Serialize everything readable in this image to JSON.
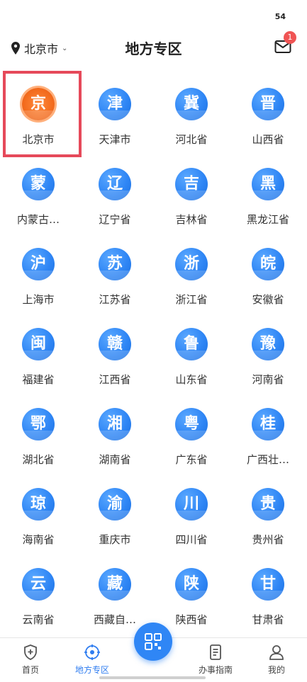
{
  "status": {
    "time": "54"
  },
  "header": {
    "location": "北京市",
    "title": "地方专区",
    "mail_badge": "1"
  },
  "regions": [
    {
      "icon_char": "京",
      "label": "北京市"
    },
    {
      "icon_char": "津",
      "label": "天津市"
    },
    {
      "icon_char": "冀",
      "label": "河北省"
    },
    {
      "icon_char": "晋",
      "label": "山西省"
    },
    {
      "icon_char": "蒙",
      "label": "内蒙古…"
    },
    {
      "icon_char": "辽",
      "label": "辽宁省"
    },
    {
      "icon_char": "吉",
      "label": "吉林省"
    },
    {
      "icon_char": "黑",
      "label": "黑龙江省"
    },
    {
      "icon_char": "沪",
      "label": "上海市"
    },
    {
      "icon_char": "苏",
      "label": "江苏省"
    },
    {
      "icon_char": "浙",
      "label": "浙江省"
    },
    {
      "icon_char": "皖",
      "label": "安徽省"
    },
    {
      "icon_char": "闽",
      "label": "福建省"
    },
    {
      "icon_char": "赣",
      "label": "江西省"
    },
    {
      "icon_char": "鲁",
      "label": "山东省"
    },
    {
      "icon_char": "豫",
      "label": "河南省"
    },
    {
      "icon_char": "鄂",
      "label": "湖北省"
    },
    {
      "icon_char": "湘",
      "label": "湖南省"
    },
    {
      "icon_char": "粤",
      "label": "广东省"
    },
    {
      "icon_char": "桂",
      "label": "广西壮…"
    },
    {
      "icon_char": "琼",
      "label": "海南省"
    },
    {
      "icon_char": "渝",
      "label": "重庆市"
    },
    {
      "icon_char": "川",
      "label": "四川省"
    },
    {
      "icon_char": "贵",
      "label": "贵州省"
    },
    {
      "icon_char": "云",
      "label": "云南省"
    },
    {
      "icon_char": "藏",
      "label": "西藏自…"
    },
    {
      "icon_char": "陕",
      "label": "陕西省"
    },
    {
      "icon_char": "甘",
      "label": "甘肃省"
    }
  ],
  "tabbar": {
    "items": [
      {
        "label": "首页",
        "icon": "shield-plus-icon"
      },
      {
        "label": "地方专区",
        "icon": "target-icon"
      },
      {
        "label": "办事指南",
        "icon": "document-icon"
      },
      {
        "label": "我的",
        "icon": "user-icon"
      }
    ],
    "center_icon": "qr-scan-icon"
  },
  "colors": {
    "accent": "#2f7df0",
    "highlight": "#e6495a",
    "beijing_icon": "#f26a1c",
    "badge": "#f05454"
  }
}
